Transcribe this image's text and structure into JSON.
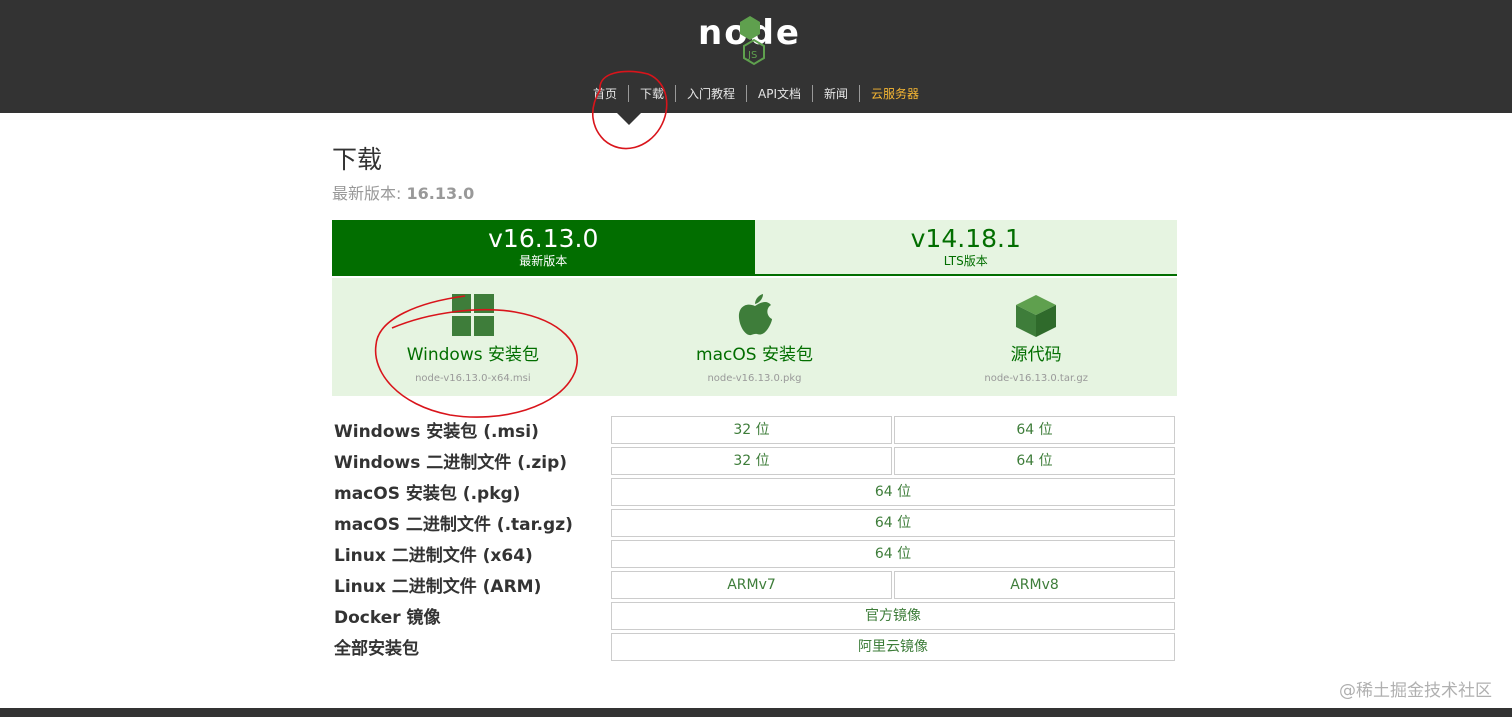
{
  "header": {
    "logo_text": "node",
    "logo_badge": "JS",
    "nav": [
      {
        "label": "首页"
      },
      {
        "label": "下载"
      },
      {
        "label": "入门教程"
      },
      {
        "label": "API文档"
      },
      {
        "label": "新闻"
      },
      {
        "label": "云服务器"
      }
    ]
  },
  "main": {
    "title": "下载",
    "latest_label": "最新版本: ",
    "latest_version": "16.13.0",
    "tabs": [
      {
        "version": "v16.13.0",
        "subtitle": "最新版本"
      },
      {
        "version": "v14.18.1",
        "subtitle": "LTS版本"
      }
    ],
    "downloads": [
      {
        "name": "Windows 安装包",
        "file": "node-v16.13.0-x64.msi",
        "icon": "windows-icon"
      },
      {
        "name": "macOS 安装包",
        "file": "node-v16.13.0.pkg",
        "icon": "apple-icon"
      },
      {
        "name": "源代码",
        "file": "node-v16.13.0.tar.gz",
        "icon": "cube-icon"
      }
    ],
    "table": [
      {
        "label": "Windows 安装包 (.msi)",
        "cells": [
          "32 位",
          "64 位"
        ]
      },
      {
        "label": "Windows 二进制文件 (.zip)",
        "cells": [
          "32 位",
          "64 位"
        ]
      },
      {
        "label": "macOS 安装包 (.pkg)",
        "cells": [
          "64 位"
        ]
      },
      {
        "label": "macOS 二进制文件 (.tar.gz)",
        "cells": [
          "64 位"
        ]
      },
      {
        "label": "Linux 二进制文件 (x64)",
        "cells": [
          "64 位"
        ]
      },
      {
        "label": "Linux 二进制文件 (ARM)",
        "cells": [
          "ARMv7",
          "ARMv8"
        ]
      },
      {
        "label": "Docker 镜像",
        "cells": [
          "官方镜像"
        ]
      },
      {
        "label": "全部安装包",
        "cells": [
          "阿里云镜像"
        ]
      }
    ]
  },
  "watermark": "@稀土掘金技术社区",
  "colors": {
    "brand_green": "#026e00",
    "light_green": "#e6f4e1",
    "header_bg": "#333333",
    "accent_orange": "#f7b733",
    "annotation_red": "#d9141b"
  }
}
